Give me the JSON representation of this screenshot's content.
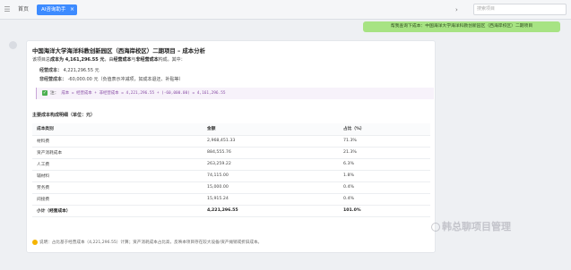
{
  "tabs": {
    "home_label": "首页",
    "active_label": "AI咨询助手",
    "close_glyph": "×"
  },
  "search": {
    "placeholder": "搜索项目"
  },
  "user_message": "帮我查询下成本：中国海洋大学海洋科教创新园区（西海岸校区）二期项目",
  "report": {
    "title": "中国海洋大学海洋科教创新园区（西海岸校区）二期项目 – 成本分析",
    "subtitle_prefix": "该项目总",
    "subtitle_total": "成本为 4,161,296.55 元",
    "subtitle_mid": "，由",
    "subtitle_ops": "经营成本",
    "subtitle_and": "与",
    "subtitle_nonops": "非经营成本",
    "subtitle_suffix": "构成。其中：",
    "ops_label": "经营成本：",
    "ops_value": "4,221,296.55 元",
    "nonops_label": "非经营成本：",
    "nonops_value": "-60,000.00 元（负值表示冲减项，如成本退还、补贴等）",
    "formula_label": "注：",
    "formula": "成本 = 经营成本 + 非经营成本 = 4,221,296.55 + (-60,000.00) = 4,161,296.55",
    "table_title": "主要成本构成明细（单位：元）",
    "table": {
      "headers": [
        "成本类别",
        "金额",
        "占比（%）"
      ],
      "rows": [
        [
          "材料费",
          "2,968,451.33",
          "71.3%"
        ],
        [
          "资产消耗成本",
          "884,555.76",
          "21.3%"
        ],
        [
          "人工费",
          "263,259.22",
          "6.3%"
        ],
        [
          "辅材料",
          "74,115.00",
          "1.8%"
        ],
        [
          "劳务费",
          "15,000.00",
          "0.4%"
        ],
        [
          "间接费",
          "15,915.24",
          "0.4%"
        ]
      ],
      "total": [
        "小计（经营成本）",
        "4,221,296.55",
        "101.0%"
      ]
    },
    "note": "说明：占比基于经营成本（4,221,296.55）计算；资产消耗成本占比高，反映本项目存在较大设备/资产摊销或折旧成本。"
  },
  "watermark": "韩总聊项目管理"
}
